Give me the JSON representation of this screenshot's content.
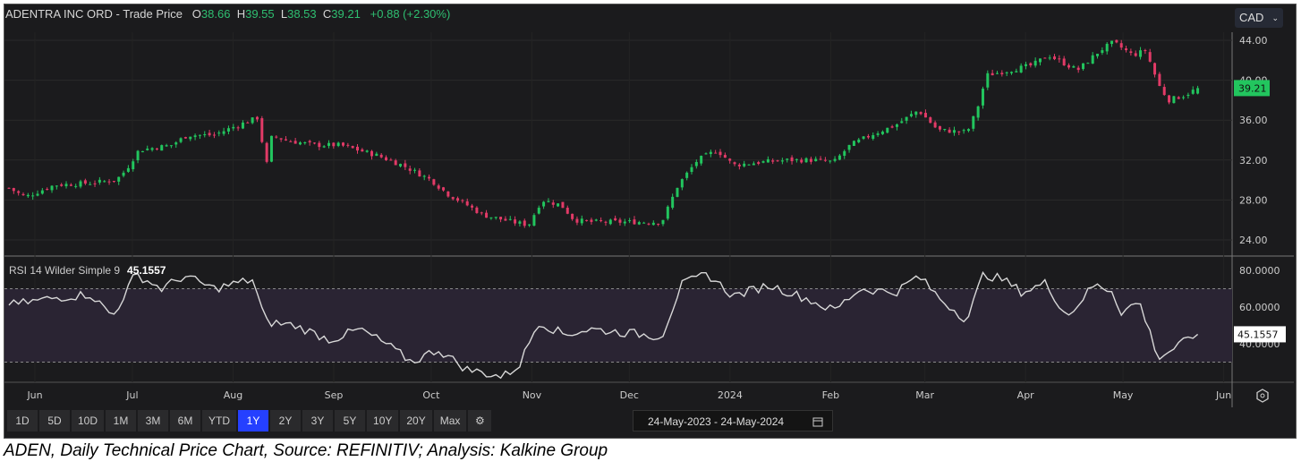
{
  "header": {
    "title": "ADENTRA INC ORD",
    "sep": " - ",
    "price_type": "Trade Price",
    "o_label": "O",
    "o": "38.66",
    "h_label": "H",
    "h": "39.55",
    "l_label": "L",
    "l": "38.53",
    "c_label": "C",
    "c": "39.21",
    "change": "+0.88 (+2.30%)"
  },
  "currency": "CAD",
  "toolbar": {
    "ranges": [
      "1D",
      "5D",
      "10D",
      "1M",
      "3M",
      "6M",
      "YTD",
      "1Y",
      "2Y",
      "3Y",
      "5Y",
      "10Y",
      "20Y",
      "Max"
    ],
    "active": "1Y",
    "date_range": "24-May-2023 - 24-May-2024"
  },
  "caption": "ADEN, Daily Technical Price Chart, Source: REFINITIV; Analysis: Kalkine Group",
  "colors": {
    "up": "#22c55e",
    "down": "#e23a67",
    "rsi": "#d8d8d8",
    "last_price_bg": "#22c55e"
  },
  "chart_data": [
    {
      "type": "candlestick",
      "title": "ADENTRA INC ORD - Trade Price",
      "ylim": [
        23,
        46
      ],
      "yticks": [
        "24.00",
        "28.00",
        "32.00",
        "36.00",
        "40.00",
        "44.00"
      ],
      "last_price": "39.21",
      "xticks": [
        "Jun",
        "Jul",
        "Aug",
        "Sep",
        "Oct",
        "Nov",
        "Dec",
        "2024",
        "Feb",
        "Mar",
        "Apr",
        "May",
        "Jun"
      ],
      "xtick_days": [
        8,
        38,
        69,
        100,
        130,
        161,
        191,
        222,
        253,
        282,
        313,
        343,
        374
      ],
      "close_path_days_price": [
        [
          0,
          29.2
        ],
        [
          5,
          28.3
        ],
        [
          14,
          29.5
        ],
        [
          25,
          29.7
        ],
        [
          33,
          30
        ],
        [
          36,
          31
        ],
        [
          40,
          33
        ],
        [
          50,
          33.5
        ],
        [
          55,
          34.5
        ],
        [
          63,
          34.5
        ],
        [
          69,
          35.3
        ],
        [
          77,
          36.3
        ],
        [
          79,
          31
        ],
        [
          81,
          34.5
        ],
        [
          85,
          34
        ],
        [
          94,
          33.5
        ],
        [
          102,
          33.5
        ],
        [
          113,
          32.5
        ],
        [
          121,
          31.5
        ],
        [
          130,
          30
        ],
        [
          135,
          28.6
        ],
        [
          141,
          27.5
        ],
        [
          146,
          26.5
        ],
        [
          155,
          25.8
        ],
        [
          160,
          25.5
        ],
        [
          164,
          28
        ],
        [
          170,
          27.5
        ],
        [
          174,
          26
        ],
        [
          179,
          25.8
        ],
        [
          190,
          25.8
        ],
        [
          201,
          25.8
        ],
        [
          206,
          29.5
        ],
        [
          212,
          32
        ],
        [
          218,
          33
        ],
        [
          223,
          31.5
        ],
        [
          232,
          31.8
        ],
        [
          240,
          32
        ],
        [
          248,
          32
        ],
        [
          254,
          31.8
        ],
        [
          259,
          33.5
        ],
        [
          266,
          34.6
        ],
        [
          273,
          35.5
        ],
        [
          280,
          37
        ],
        [
          286,
          35
        ],
        [
          295,
          34.8
        ],
        [
          298,
          37
        ],
        [
          301,
          40.5
        ],
        [
          308,
          41
        ],
        [
          315,
          41.5
        ],
        [
          320,
          42.5
        ],
        [
          329,
          41
        ],
        [
          336,
          43
        ],
        [
          340,
          43.8
        ],
        [
          346,
          42.5
        ],
        [
          350,
          43
        ],
        [
          354,
          39.5
        ],
        [
          357,
          38
        ],
        [
          362,
          38.5
        ],
        [
          366,
          39.21
        ]
      ]
    },
    {
      "type": "line",
      "title": "RSI 14 Wilder Simple 9",
      "last_value": "45.1557",
      "ylim": [
        17,
        88
      ],
      "yticks": [
        "40.0000",
        "60.0000",
        "80.0000"
      ],
      "bands": [
        30,
        70
      ],
      "path_days_value": [
        [
          0,
          61
        ],
        [
          14,
          65
        ],
        [
          25,
          67
        ],
        [
          32,
          55
        ],
        [
          39,
          78
        ],
        [
          47,
          70
        ],
        [
          54,
          77
        ],
        [
          63,
          70
        ],
        [
          75,
          75
        ],
        [
          79,
          52
        ],
        [
          88,
          50
        ],
        [
          99,
          42
        ],
        [
          108,
          48
        ],
        [
          116,
          40
        ],
        [
          124,
          30
        ],
        [
          132,
          37
        ],
        [
          141,
          26
        ],
        [
          152,
          22
        ],
        [
          157,
          28
        ],
        [
          163,
          52
        ],
        [
          171,
          45
        ],
        [
          179,
          48
        ],
        [
          190,
          46
        ],
        [
          201,
          44
        ],
        [
          207,
          72
        ],
        [
          215,
          78
        ],
        [
          223,
          66
        ],
        [
          234,
          72
        ],
        [
          245,
          65
        ],
        [
          254,
          58
        ],
        [
          262,
          70
        ],
        [
          273,
          68
        ],
        [
          280,
          77
        ],
        [
          287,
          64
        ],
        [
          295,
          53
        ],
        [
          300,
          78
        ],
        [
          306,
          75
        ],
        [
          312,
          68
        ],
        [
          319,
          73
        ],
        [
          326,
          55
        ],
        [
          334,
          72
        ],
        [
          340,
          69
        ],
        [
          342,
          57
        ],
        [
          348,
          63
        ],
        [
          354,
          32
        ],
        [
          359,
          38
        ],
        [
          366,
          45.16
        ]
      ]
    }
  ]
}
